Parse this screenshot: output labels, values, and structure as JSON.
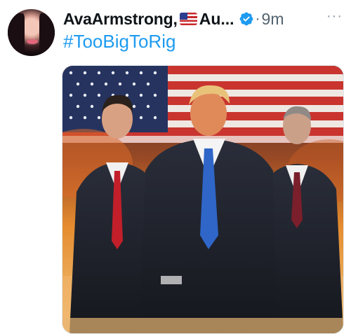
{
  "post": {
    "display_name": "AvaArmstrong,",
    "flag_emoji": "us-flag-emoji",
    "name_rest": "Au",
    "ellipsis": "...",
    "verified_icon": "verified-badge-icon",
    "separator": "·",
    "timestamp": "9m",
    "more_icon": "more-options-icon",
    "more_label": "···",
    "hashtag": "#TooBigToRig"
  },
  "colors": {
    "link": "#1d9bf0",
    "verified": "#1d9bf0",
    "text": "#0f1419",
    "muted": "#536471"
  }
}
